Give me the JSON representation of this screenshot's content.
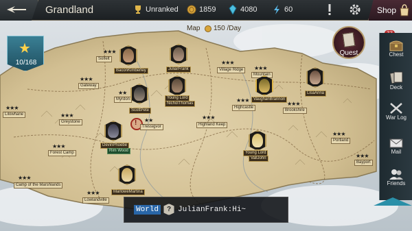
{
  "header": {
    "title": "Grandland",
    "ranking": "Unranked",
    "gold": "1859",
    "crystals": "4080",
    "energy": "60",
    "shop_label": "Shop"
  },
  "stars": {
    "count": "10/168"
  },
  "map": {
    "label": "Map",
    "rate": "150 /Day"
  },
  "locations": [
    "BaconKimberley",
    "Solfelt",
    "Gateway",
    "Myrdon",
    "JuliarFrank",
    "Village Ridge",
    "Mountain",
    "Lilowhane",
    "Young Lord",
    "NicholThomas",
    "ScottPete",
    "Highcastle",
    "VaughanBrannon",
    "Brookshire",
    "LisaAnna",
    "Greystone",
    "Highland Keep",
    "Tressigvor",
    "DevinPhoebe",
    "Forest Camp",
    "Rim Wood",
    "Portland",
    "Young Lord",
    "VallJohn",
    "Bayport",
    "Camp of the Marshlands",
    "MarloweMartina",
    "Lowlandville"
  ],
  "quest_label": "Quest",
  "sidebar": [
    {
      "label": "Chest",
      "icon": "chest-icon"
    },
    {
      "label": "Deck",
      "icon": "deck-icon"
    },
    {
      "label": "War Log",
      "icon": "war-log-icon"
    },
    {
      "label": "Mail",
      "icon": "mail-icon"
    },
    {
      "label": "Friends",
      "icon": "friends-icon"
    }
  ],
  "chest_badge": "33",
  "chat": {
    "channel": "World",
    "message": "JulianFrank:Hi~"
  },
  "colors": {
    "accent": "#2966a8",
    "map_parchment": "#d9c9a0",
    "frame_gold": "#b89c5a"
  }
}
